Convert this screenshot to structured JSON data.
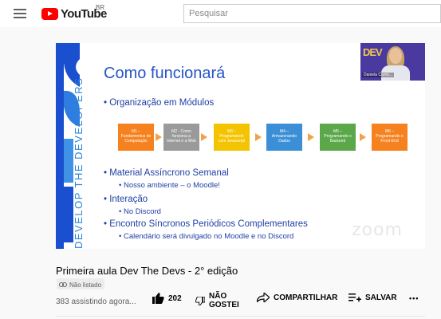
{
  "header": {
    "logo_text": "YouTube",
    "country": "BR",
    "search_placeholder": "Pesquisar"
  },
  "slide": {
    "side_text": "DEVELOP THE DEVELOPERS",
    "title": "Como funcionará",
    "bullets": [
      "• Organização em Módulos",
      "• Material Assíncrono Semanal",
      "• Interação",
      "• Encontro Síncronos Periódicos Complementares"
    ],
    "subbullets": [
      "• Nosso ambiente – o Moodle!",
      "• No Discord",
      "• Calendário será divulgado no Moodle e no Discord"
    ],
    "modules": [
      {
        "label": "M1 – Fundamentos de Computação",
        "color": "#f5821f"
      },
      {
        "label": "M2 - Como funciona a Internet e a Web",
        "color": "#9a9a9a"
      },
      {
        "label": "M3 – Programando com Javascript",
        "color": "#f5c400"
      },
      {
        "label": "M4 – Armazenando Dados",
        "color": "#3a8fd6"
      },
      {
        "label": "M5 – Programando o Backend",
        "color": "#5ba84a"
      },
      {
        "label": "M6 – Programando o Front-End",
        "color": "#f5821f"
      }
    ],
    "webcam_name": "Daniela Carrio...",
    "webcam_logo": "DEV",
    "zoom_watermark": "zoom"
  },
  "video": {
    "title": "Primeira aula Dev The Devs - 2° edição",
    "status": "Não listado",
    "views": "383 assistindo agora...",
    "likes": "202",
    "dislike_label_1": "NÃO",
    "dislike_label_2": "GOSTEI",
    "share_label": "COMPARTILHAR",
    "save_label": "SALVAR",
    "more": "•••"
  }
}
